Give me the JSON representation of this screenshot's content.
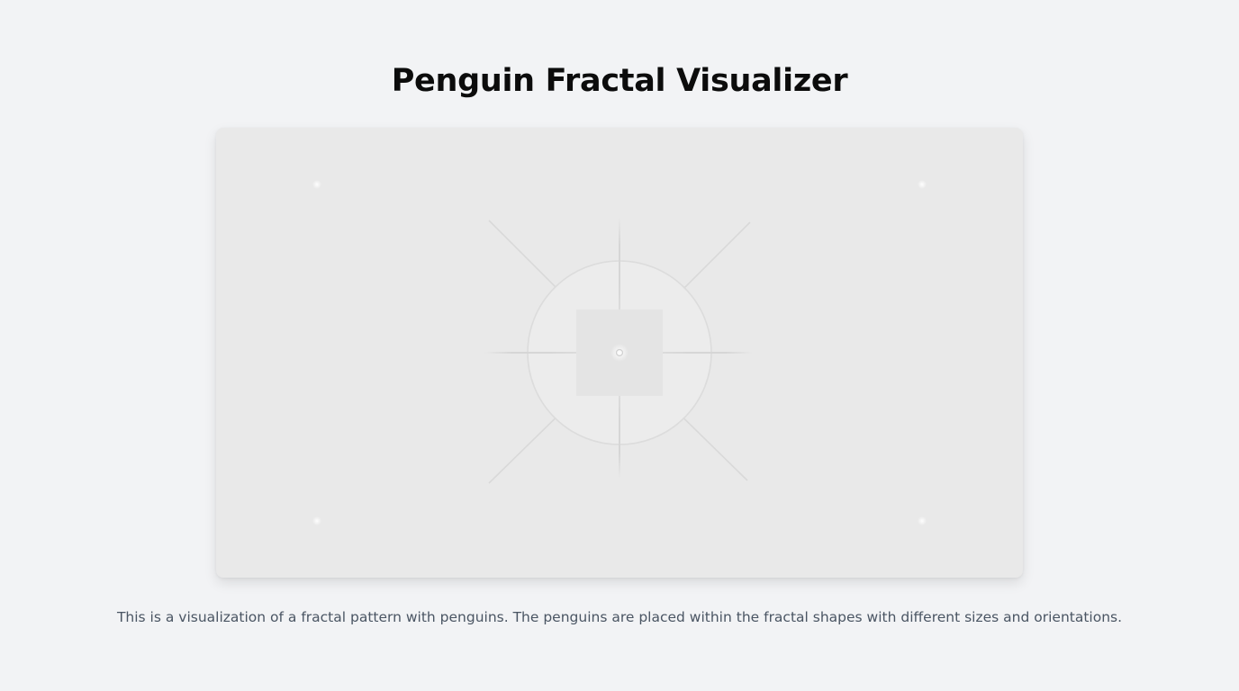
{
  "page": {
    "title": "Penguin Fractal Visualizer",
    "description": "This is a visualization of a fractal pattern with penguins. The penguins are placed within the fractal shapes with different sizes and orientations."
  },
  "canvas": {
    "background_color": "#e9e9e9",
    "line_color": "#d8d8d8",
    "circle_fill": "#ececec",
    "square_fill": "#e4e4e4",
    "corner_dot_color": "#f6f6f6"
  }
}
